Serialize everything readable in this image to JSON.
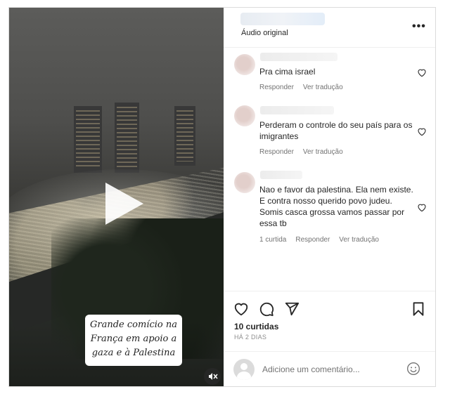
{
  "post": {
    "audio_label": "Áudio original",
    "more_label": "•••",
    "video_caption": [
      "Grande comício na",
      "França em apoio a",
      "gaza e à Palestina"
    ]
  },
  "comments": [
    {
      "text": "Pra cima israel",
      "reply": "Responder",
      "translate": "Ver tradução"
    },
    {
      "text": "Perderam o controle do seu país para os imigrantes",
      "reply": "Responder",
      "translate": "Ver tradução"
    },
    {
      "text": "Nao e favor da palestina. Ela nem existe. E contra nosso querido povo judeu. Somis casca grossa vamos passar por essa tb",
      "likes": "1 curtida",
      "reply": "Responder",
      "translate": "Ver tradução"
    }
  ],
  "actions": {
    "likes": "10 curtidas",
    "time": "HÁ 2 DIAS"
  },
  "add_comment": {
    "placeholder": "Adicione um comentário..."
  },
  "icons": [
    "play-icon",
    "mute-icon",
    "more-icon",
    "heart-icon",
    "comment-icon",
    "share-icon",
    "bookmark-icon",
    "emoji-icon"
  ]
}
